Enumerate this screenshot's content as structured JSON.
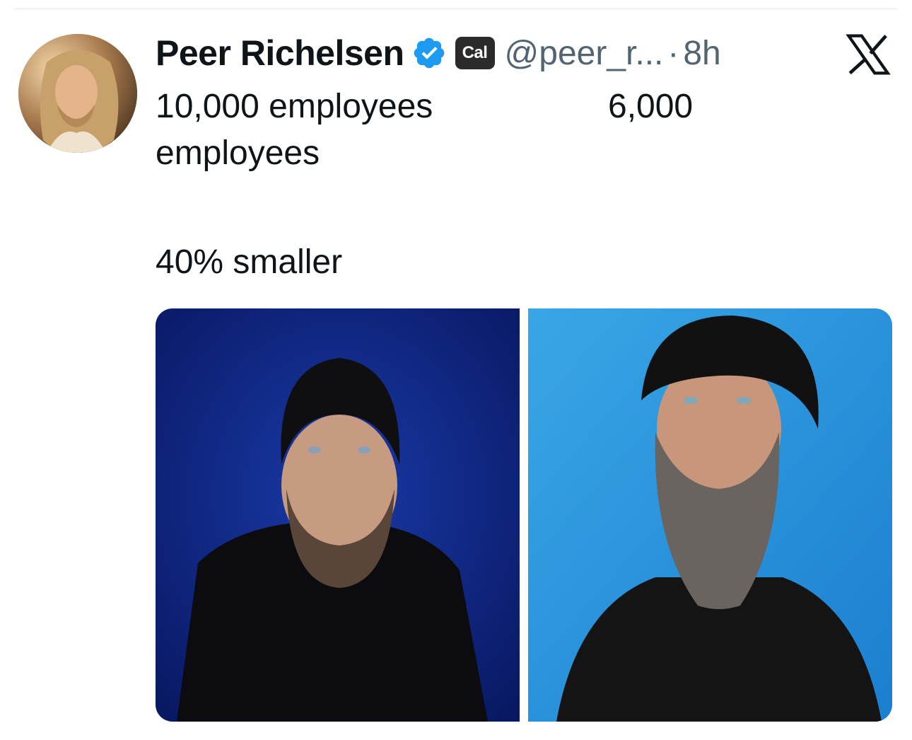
{
  "post": {
    "display_name": "Peer Richelsen",
    "badge": "Cal",
    "handle": "@peer_r...",
    "separator": "·",
    "time": "8h",
    "text": {
      "line1_left": "10,000 employees",
      "line1_right": "6,000",
      "line2": "employees",
      "line3": "40% smaller"
    }
  },
  "icons": {
    "verified": "verified-badge-icon",
    "x_logo": "x-logo-icon"
  },
  "colors": {
    "verified_blue": "#1d9bf0",
    "handle_gray": "#536471",
    "text": "#0f1419"
  }
}
